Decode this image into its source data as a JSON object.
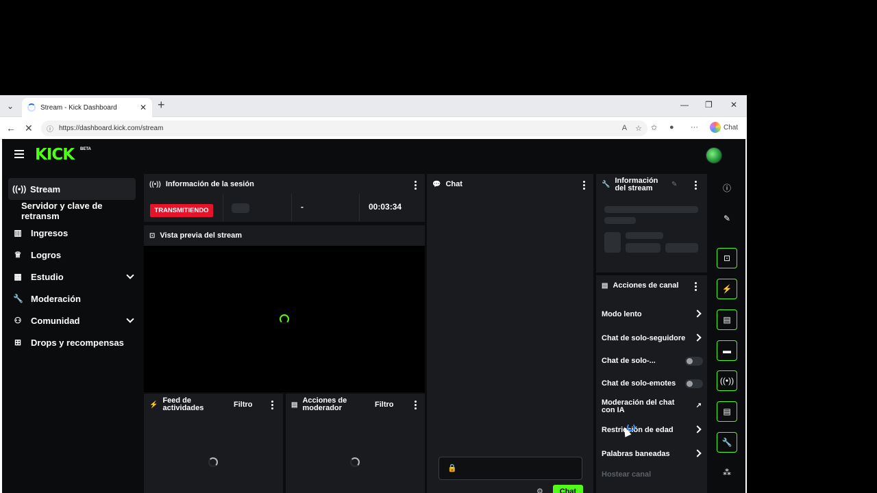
{
  "browser": {
    "tab_title": "Stream - Kick Dashboard",
    "url": "https://dashboard.kick.com/stream",
    "copilot_label": "Chat"
  },
  "app": {
    "logo": "KICK",
    "logo_badge": "BETA"
  },
  "sidebar": {
    "items": [
      {
        "label": "Stream",
        "icon": "broadcast-icon"
      },
      {
        "label": "Servidor y clave de retransm",
        "icon": ""
      },
      {
        "label": "Ingresos",
        "icon": "chart-icon"
      },
      {
        "label": "Logros",
        "icon": "trophy-icon"
      },
      {
        "label": "Estudio",
        "icon": "studio-icon"
      },
      {
        "label": "Moderación",
        "icon": "wrench-icon"
      },
      {
        "label": "Comunidad",
        "icon": "community-icon"
      },
      {
        "label": "Drops y recompensas",
        "icon": "gift-icon"
      }
    ]
  },
  "session": {
    "title": "Información de la sesión",
    "status": "TRANSMITIENDO",
    "viewers": "-",
    "duration": "00:03:34"
  },
  "preview": {
    "title": "Vista previa del stream"
  },
  "feed": {
    "title": "Feed de actividades",
    "filter": "Filtro"
  },
  "mod_actions": {
    "title": "Acciones de moderador",
    "filter": "Filtro"
  },
  "chat": {
    "title": "Chat",
    "send_label": "Chat"
  },
  "stream_info": {
    "title": "Información del stream"
  },
  "channel_actions": {
    "title": "Acciones de canal",
    "items": [
      {
        "label": "Modo lento",
        "control": "arrow"
      },
      {
        "label": "Chat de solo-seguidore",
        "control": "arrow"
      },
      {
        "label": "Chat de solo-...",
        "control": "toggle"
      },
      {
        "label": "Chat de solo-emotes",
        "control": "toggle"
      },
      {
        "label": "Moderación del chat con IA",
        "control": "external"
      },
      {
        "label": "Restricción de edad",
        "control": "arrow"
      },
      {
        "label": "Palabras baneadas",
        "control": "arrow"
      },
      {
        "label": "Hostear canal",
        "control": "none"
      }
    ]
  },
  "colors": {
    "brand": "#53fc18",
    "live": "#e5142a",
    "panel": "#191b1f"
  }
}
